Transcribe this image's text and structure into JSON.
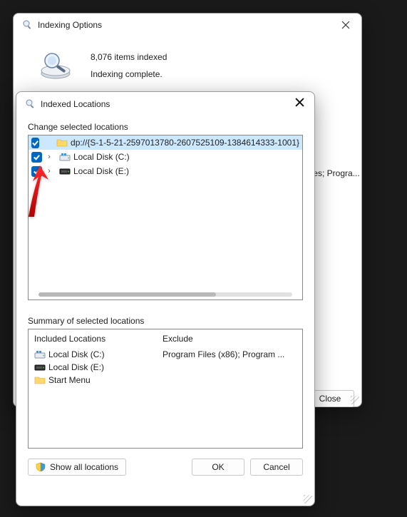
{
  "backWindow": {
    "title": "Indexing Options",
    "itemsIndexed": "8,076 items indexed",
    "status": "Indexing complete.",
    "truncated": "iles; Progra...",
    "closeLabel": "Close"
  },
  "frontWindow": {
    "title": "Indexed Locations",
    "changeLabel": "Change selected locations",
    "tree": [
      {
        "checked": true,
        "hasExpander": false,
        "indent": 0,
        "icon": "folder",
        "label": "dp://{S-1-5-21-2597013780-2607525109-1384614333-1001}",
        "selected": true
      },
      {
        "checked": true,
        "hasExpander": true,
        "indent": 0,
        "icon": "drive-c",
        "label": "Local Disk (C:)",
        "selected": false
      },
      {
        "checked": true,
        "hasExpander": true,
        "indent": 0,
        "icon": "drive-e",
        "label": "Local Disk (E:)",
        "selected": false
      }
    ],
    "summaryLabel": "Summary of selected locations",
    "summaryHeaders": {
      "included": "Included Locations",
      "exclude": "Exclude"
    },
    "summaryRows": [
      {
        "icon": "drive-c",
        "label": "Local Disk (C:)",
        "exclude": "Program Files (x86); Program ..."
      },
      {
        "icon": "drive-e",
        "label": "Local Disk (E:)",
        "exclude": ""
      },
      {
        "icon": "folder",
        "label": "Start Menu",
        "exclude": ""
      }
    ],
    "showAll": "Show all locations",
    "ok": "OK",
    "cancel": "Cancel"
  }
}
